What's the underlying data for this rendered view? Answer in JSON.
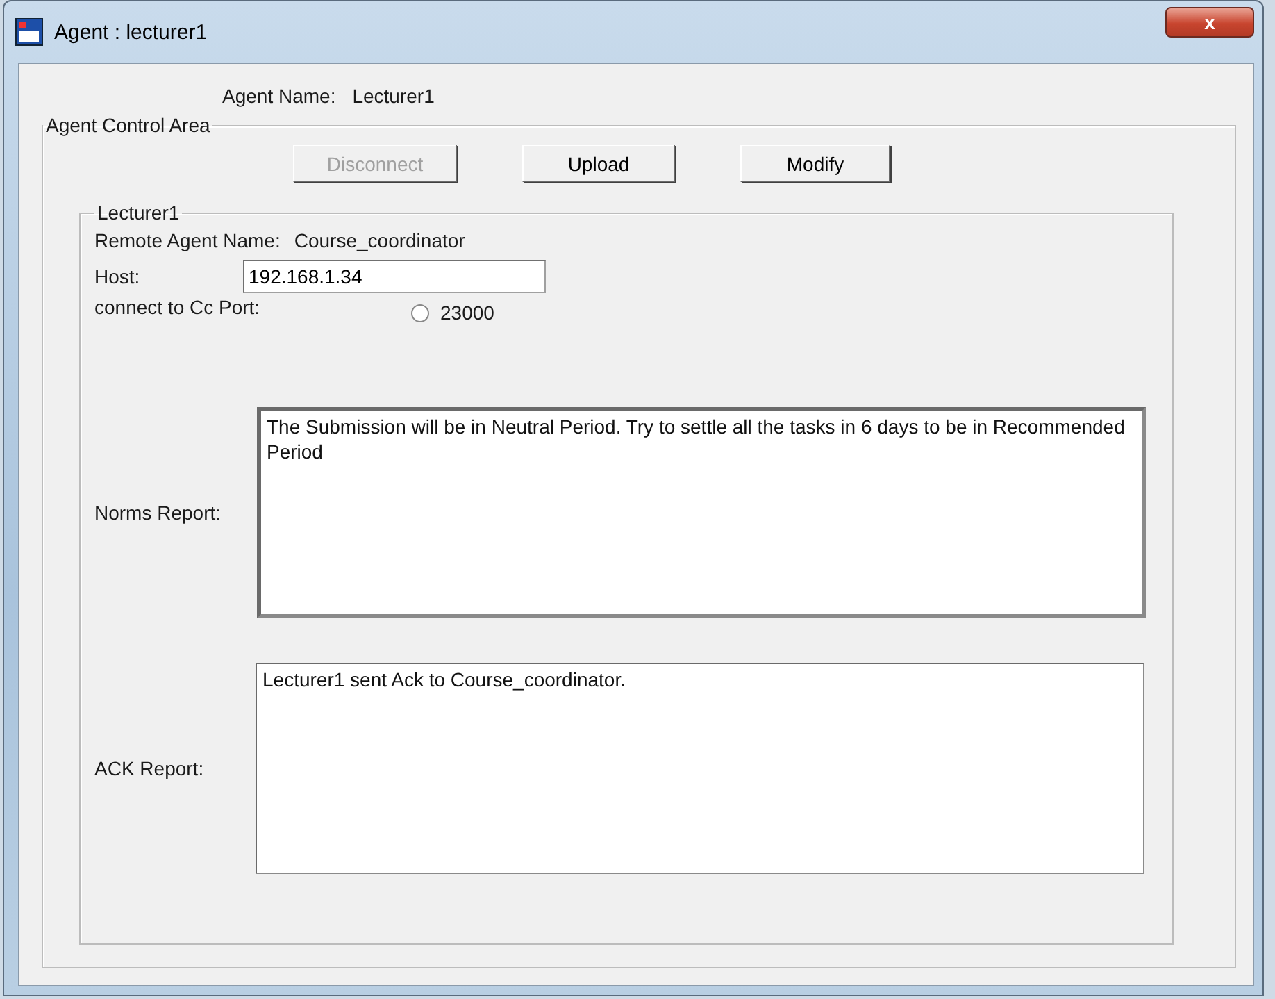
{
  "window": {
    "title": "Agent : lecturer1",
    "close": "x"
  },
  "agent_name": {
    "label": "Agent Name:",
    "value": "Lecturer1"
  },
  "control_area": {
    "title": "Agent Control Area",
    "buttons": [
      {
        "label": "Disconnect",
        "disabled": true
      },
      {
        "label": "Upload",
        "disabled": false
      },
      {
        "label": "Modify",
        "disabled": false
      }
    ],
    "agent_group": {
      "title": "Lecturer1",
      "remote_agent": {
        "label": "Remote Agent Name:",
        "value": "Course_coordinator"
      },
      "host": {
        "label": "Host:",
        "value": "192.168.1.34"
      },
      "port": {
        "label": "connect to Cc Port:",
        "option": "23000",
        "selected": false
      },
      "norms_report": {
        "label": "Norms Report:",
        "value": "The Submission will be in Neutral Period. Try to settle all the tasks in 6 days to be in Recommended Period"
      },
      "ack_report": {
        "label": "ACK Report:",
        "value": "Lecturer1 sent Ack to Course_coordinator."
      }
    }
  }
}
